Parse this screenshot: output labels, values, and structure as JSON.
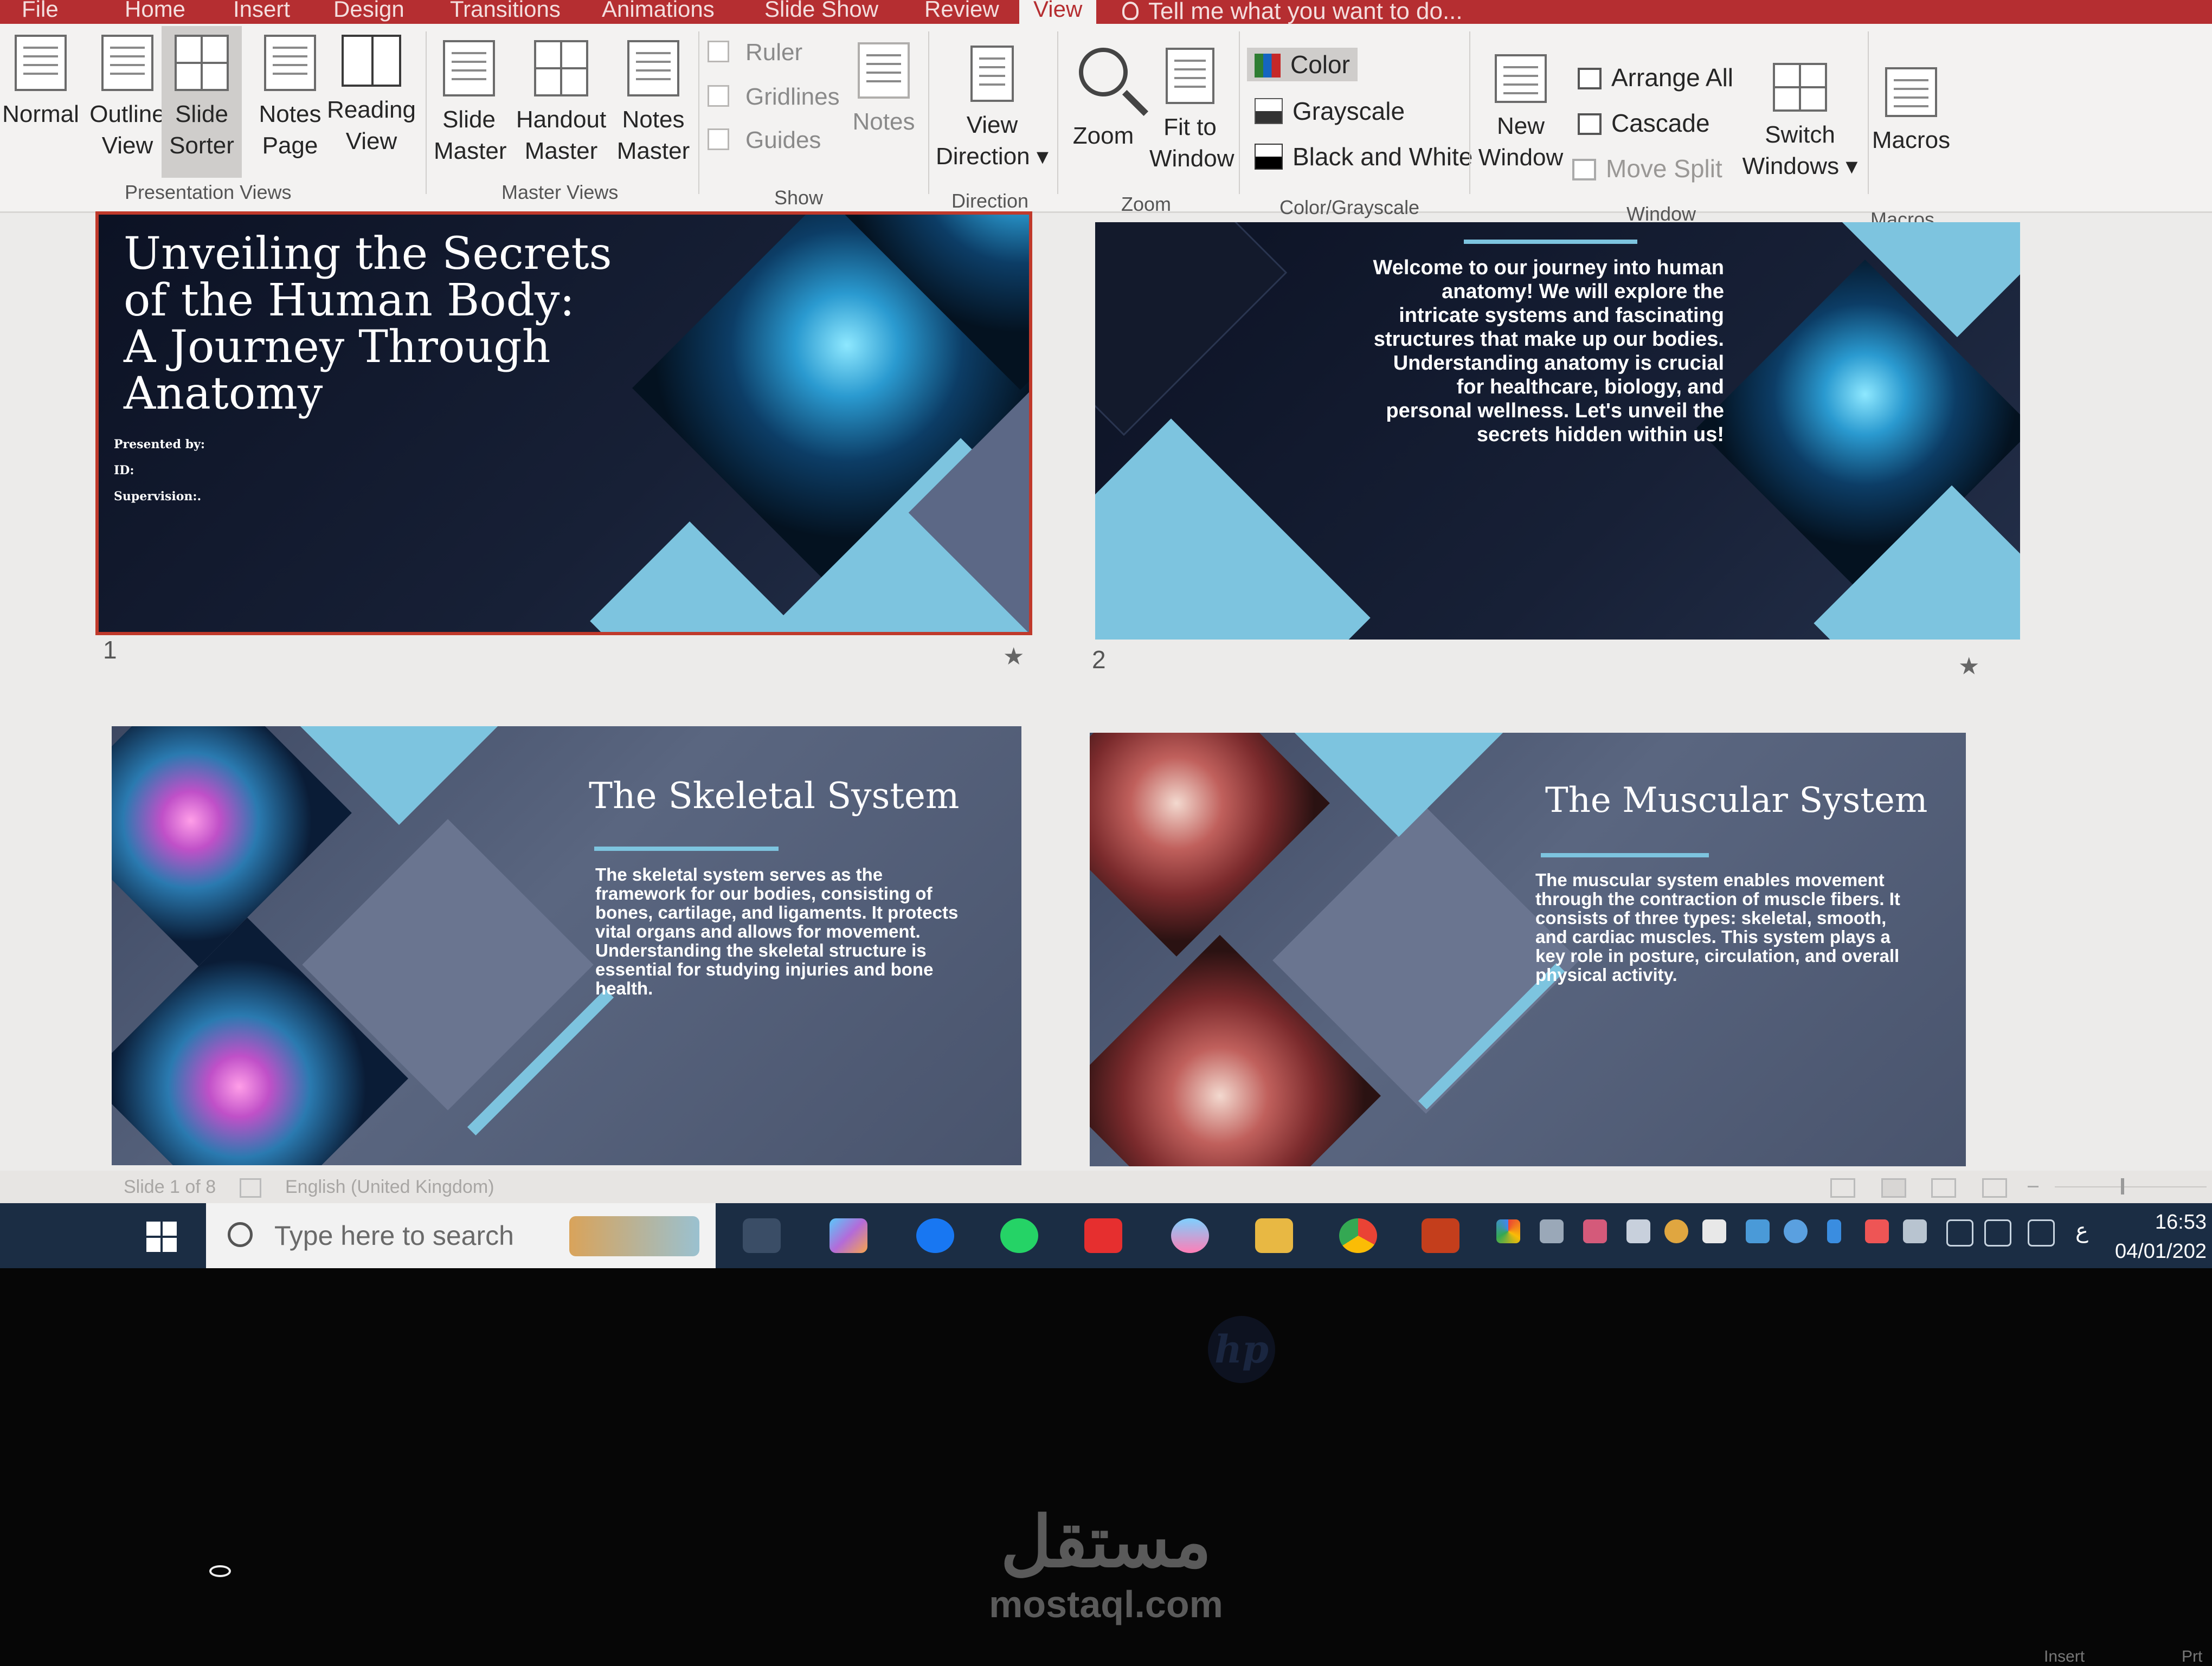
{
  "ribbon": {
    "tabs": [
      "File",
      "Home",
      "Insert",
      "Design",
      "Transitions",
      "Animations",
      "Slide Show",
      "Review",
      "View"
    ],
    "active_tab": "View",
    "tell_me": "Tell me what you want to do...",
    "presentation_views": {
      "normal": "Normal",
      "outline": [
        "Outline",
        "View"
      ],
      "slide_sorter": [
        "Slide",
        "Sorter"
      ],
      "notes_page": [
        "Notes",
        "Page"
      ],
      "reading_view": [
        "Reading",
        "View"
      ],
      "group": "Presentation Views"
    },
    "master_views": {
      "slide_master": [
        "Slide",
        "Master"
      ],
      "handout_master": [
        "Handout",
        "Master"
      ],
      "notes_master": [
        "Notes",
        "Master"
      ],
      "group": "Master Views"
    },
    "show": {
      "ruler": "Ruler",
      "gridlines": "Gridlines",
      "guides": "Guides",
      "notes": "Notes",
      "group": "Show"
    },
    "direction": {
      "view_direction": [
        "View",
        "Direction"
      ],
      "group": "Direction"
    },
    "zoom": {
      "zoom": "Zoom",
      "fit": [
        "Fit to",
        "Window"
      ],
      "group": "Zoom"
    },
    "color": {
      "color": "Color",
      "grayscale": "Grayscale",
      "bw": "Black and White",
      "group": "Color/Grayscale"
    },
    "window": {
      "new_window": [
        "New",
        "Window"
      ],
      "arrange_all": "Arrange All",
      "cascade": "Cascade",
      "move_split": "Move Split",
      "switch": [
        "Switch",
        "Windows"
      ],
      "group": "Window"
    },
    "macros": {
      "label": "Macros",
      "group": "Macros"
    }
  },
  "slides": [
    {
      "num": "1",
      "title": [
        "Unveiling the Secrets",
        "of the Human Body:",
        "A Journey Through",
        "Anatomy"
      ],
      "fields": [
        "Presented by:",
        "ID:",
        "Supervision:."
      ]
    },
    {
      "num": "2",
      "body": [
        "Welcome to our journey into human",
        "anatomy! We will explore the",
        "intricate systems and fascinating",
        "structures  that make up our bodies.",
        "Understanding anatomy is crucial",
        "for healthcare, biology, and",
        "personal wellness. Let's unveil the",
        "secrets hidden within us!"
      ]
    },
    {
      "title": "The Skeletal System",
      "body": [
        "The skeletal system serves as the",
        "framework for our bodies, consisting of",
        "bones, cartilage, and ligaments. It protects",
        "vital organs and allows for movement.",
        "Understanding the skeletal structure is",
        "essential for studying injuries and bone",
        "health."
      ]
    },
    {
      "title": "The Muscular System",
      "body": [
        "The muscular system enables movement",
        "through the contraction of muscle fibers. It",
        "consists of three types: skeletal, smooth,",
        "and cardiac muscles. This system plays a",
        "key role in posture, circulation, and overall",
        "physical activity."
      ]
    }
  ],
  "status": {
    "slide_count": "Slide 1 of 8",
    "language": "English (United Kingdom)"
  },
  "taskbar": {
    "search_placeholder": "Type here to search",
    "time": "16:53",
    "date": "04/01/202",
    "lang": "ع"
  },
  "watermark": {
    "arabic": "مستقل",
    "latin": "mostaql.com"
  },
  "keyboard": [
    "Insert",
    "Prt"
  ],
  "colors": {
    "accent": "#b52e31",
    "light_blue": "#7dc4df",
    "taskbar": "#1b2d44"
  }
}
